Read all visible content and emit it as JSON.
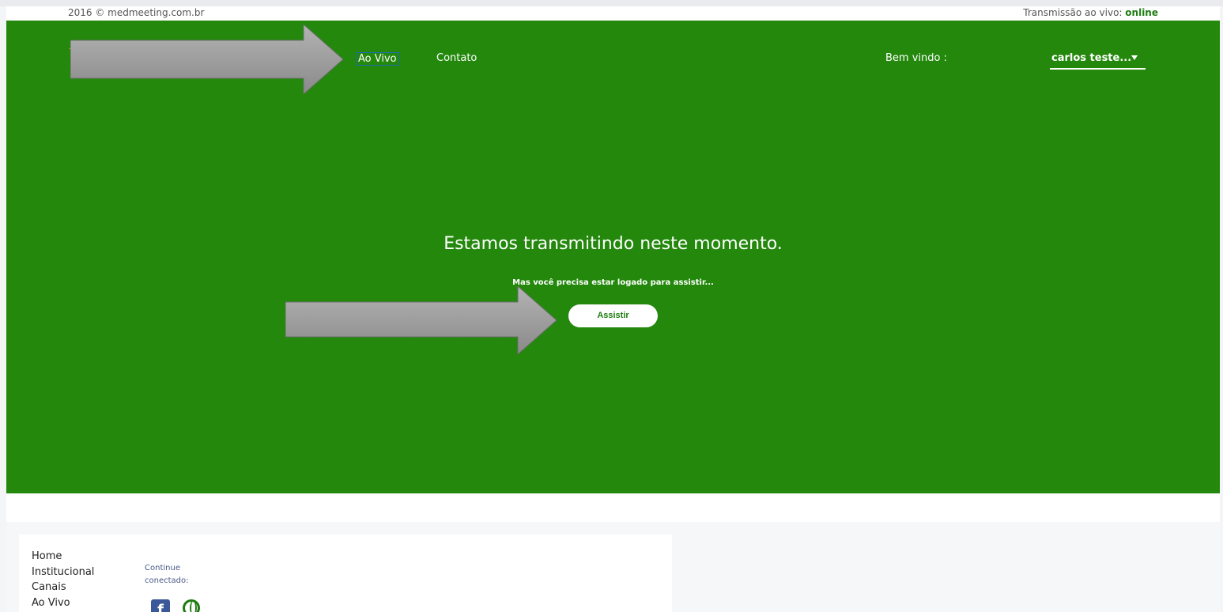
{
  "header": {
    "copyright": "2016 © medmeeting.com.br",
    "live_label": "Transmissão ao vivo: ",
    "live_status": "online"
  },
  "nav": {
    "items": [
      {
        "label": "Ao Vivo"
      },
      {
        "label": "Contato"
      }
    ],
    "welcome": "Bem vindo :",
    "user_name": "carlos teste..."
  },
  "hero": {
    "title": "Estamos transmitindo neste momento.",
    "subtitle": "Mas você precisa estar logado para assistir...",
    "button_label": "Assistir"
  },
  "footer": {
    "links": [
      "Home",
      "Institucional",
      "Canais",
      "Ao Vivo"
    ],
    "connected_label": "Continue conectado:",
    "social_icons": [
      "facebook-icon",
      "globe-icon"
    ]
  },
  "colors": {
    "hero_bg": "#23880c",
    "accent_green": "#1e7d10",
    "page_bg": "#f4f5f6",
    "annotation_arrow": "#9a9a9a"
  }
}
